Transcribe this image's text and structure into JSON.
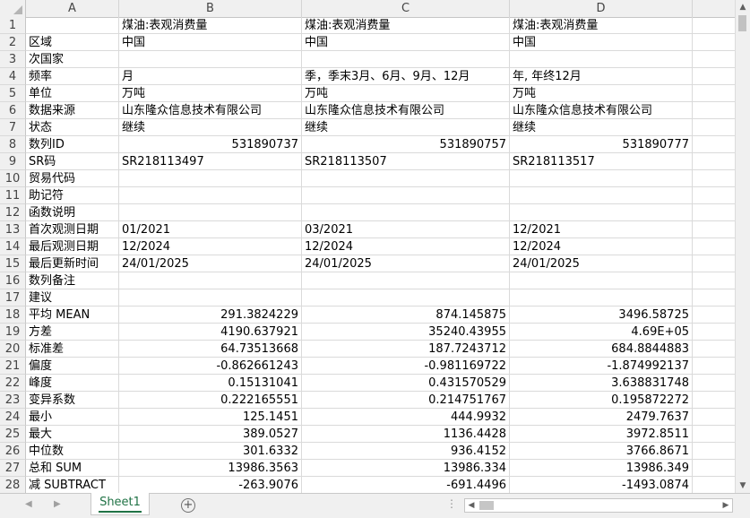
{
  "columns": [
    "A",
    "B",
    "C",
    "D"
  ],
  "rows": [
    {
      "num": "1",
      "a": "",
      "b": "煤油:表观消费量",
      "c": "煤油:表观消费量",
      "d": "煤油:表观消费量",
      "align": "text"
    },
    {
      "num": "2",
      "a": "区域",
      "b": "中国",
      "c": "中国",
      "d": "中国",
      "align": "text"
    },
    {
      "num": "3",
      "a": "次国家",
      "b": "",
      "c": "",
      "d": "",
      "align": "text"
    },
    {
      "num": "4",
      "a": "频率",
      "b": "月",
      "c": "季，季末3月、6月、9月、12月",
      "d": "年, 年终12月",
      "align": "text"
    },
    {
      "num": "5",
      "a": "单位",
      "b": "万吨",
      "c": "万吨",
      "d": "万吨",
      "align": "text"
    },
    {
      "num": "6",
      "a": "数据来源",
      "b": "山东隆众信息技术有限公司",
      "c": "山东隆众信息技术有限公司",
      "d": "山东隆众信息技术有限公司",
      "align": "text"
    },
    {
      "num": "7",
      "a": "状态",
      "b": "继续",
      "c": "继续",
      "d": "继续",
      "align": "text"
    },
    {
      "num": "8",
      "a": "数列ID",
      "b": "531890737",
      "c": "531890757",
      "d": "531890777",
      "align": "num"
    },
    {
      "num": "9",
      "a": "SR码",
      "b": "SR218113497",
      "c": "SR218113507",
      "d": "SR218113517",
      "align": "text"
    },
    {
      "num": "10",
      "a": "贸易代码",
      "b": "",
      "c": "",
      "d": "",
      "align": "text"
    },
    {
      "num": "11",
      "a": "助记符",
      "b": "",
      "c": "",
      "d": "",
      "align": "text"
    },
    {
      "num": "12",
      "a": "函数说明",
      "b": "",
      "c": "",
      "d": "",
      "align": "text"
    },
    {
      "num": "13",
      "a": "首次观测日期",
      "b": "01/2021",
      "c": "03/2021",
      "d": "12/2021",
      "align": "text"
    },
    {
      "num": "14",
      "a": "最后观测日期",
      "b": "12/2024",
      "c": "12/2024",
      "d": "12/2024",
      "align": "text"
    },
    {
      "num": "15",
      "a": "最后更新时间",
      "b": "24/01/2025",
      "c": "24/01/2025",
      "d": "24/01/2025",
      "align": "text"
    },
    {
      "num": "16",
      "a": "数列备注",
      "b": "",
      "c": "",
      "d": "",
      "align": "text"
    },
    {
      "num": "17",
      "a": "建议",
      "b": "",
      "c": "",
      "d": "",
      "align": "text"
    },
    {
      "num": "18",
      "a": "平均 MEAN",
      "b": "291.3824229",
      "c": "874.145875",
      "d": "3496.58725",
      "align": "num"
    },
    {
      "num": "19",
      "a": "方差",
      "b": "4190.637921",
      "c": "35240.43955",
      "d": "4.69E+05",
      "align": "num"
    },
    {
      "num": "20",
      "a": "标准差",
      "b": "64.73513668",
      "c": "187.7243712",
      "d": "684.8844883",
      "align": "num"
    },
    {
      "num": "21",
      "a": "偏度",
      "b": "-0.862661243",
      "c": "-0.981169722",
      "d": "-1.874992137",
      "align": "num"
    },
    {
      "num": "22",
      "a": "峰度",
      "b": "0.15131041",
      "c": "0.431570529",
      "d": "3.638831748",
      "align": "num"
    },
    {
      "num": "23",
      "a": "变异系数",
      "b": "0.222165551",
      "c": "0.214751767",
      "d": "0.195872272",
      "align": "num"
    },
    {
      "num": "24",
      "a": "最小",
      "b": "125.1451",
      "c": "444.9932",
      "d": "2479.7637",
      "align": "num"
    },
    {
      "num": "25",
      "a": "最大",
      "b": "389.0527",
      "c": "1136.4428",
      "d": "3972.8511",
      "align": "num"
    },
    {
      "num": "26",
      "a": "中位数",
      "b": "301.6332",
      "c": "936.4152",
      "d": "3766.8671",
      "align": "num"
    },
    {
      "num": "27",
      "a": "总和 SUM",
      "b": "13986.3563",
      "c": "13986.334",
      "d": "13986.349",
      "align": "num"
    },
    {
      "num": "28",
      "a": "减 SUBTRACT",
      "b": "-263.9076",
      "c": "-691.4496",
      "d": "-1493.0874",
      "align": "num"
    }
  ],
  "sheet_tab": "Sheet1",
  "icons": {
    "add_sheet": "+",
    "nav_prev": "◀",
    "nav_next": "▶",
    "scroll_up": "▲",
    "scroll_down": "▼",
    "scroll_left": "◀",
    "scroll_right": "▶",
    "options": "⋮"
  },
  "colors": {
    "accent": "#217346",
    "header_bg": "#f0f0f0",
    "gridline": "#dadada"
  }
}
